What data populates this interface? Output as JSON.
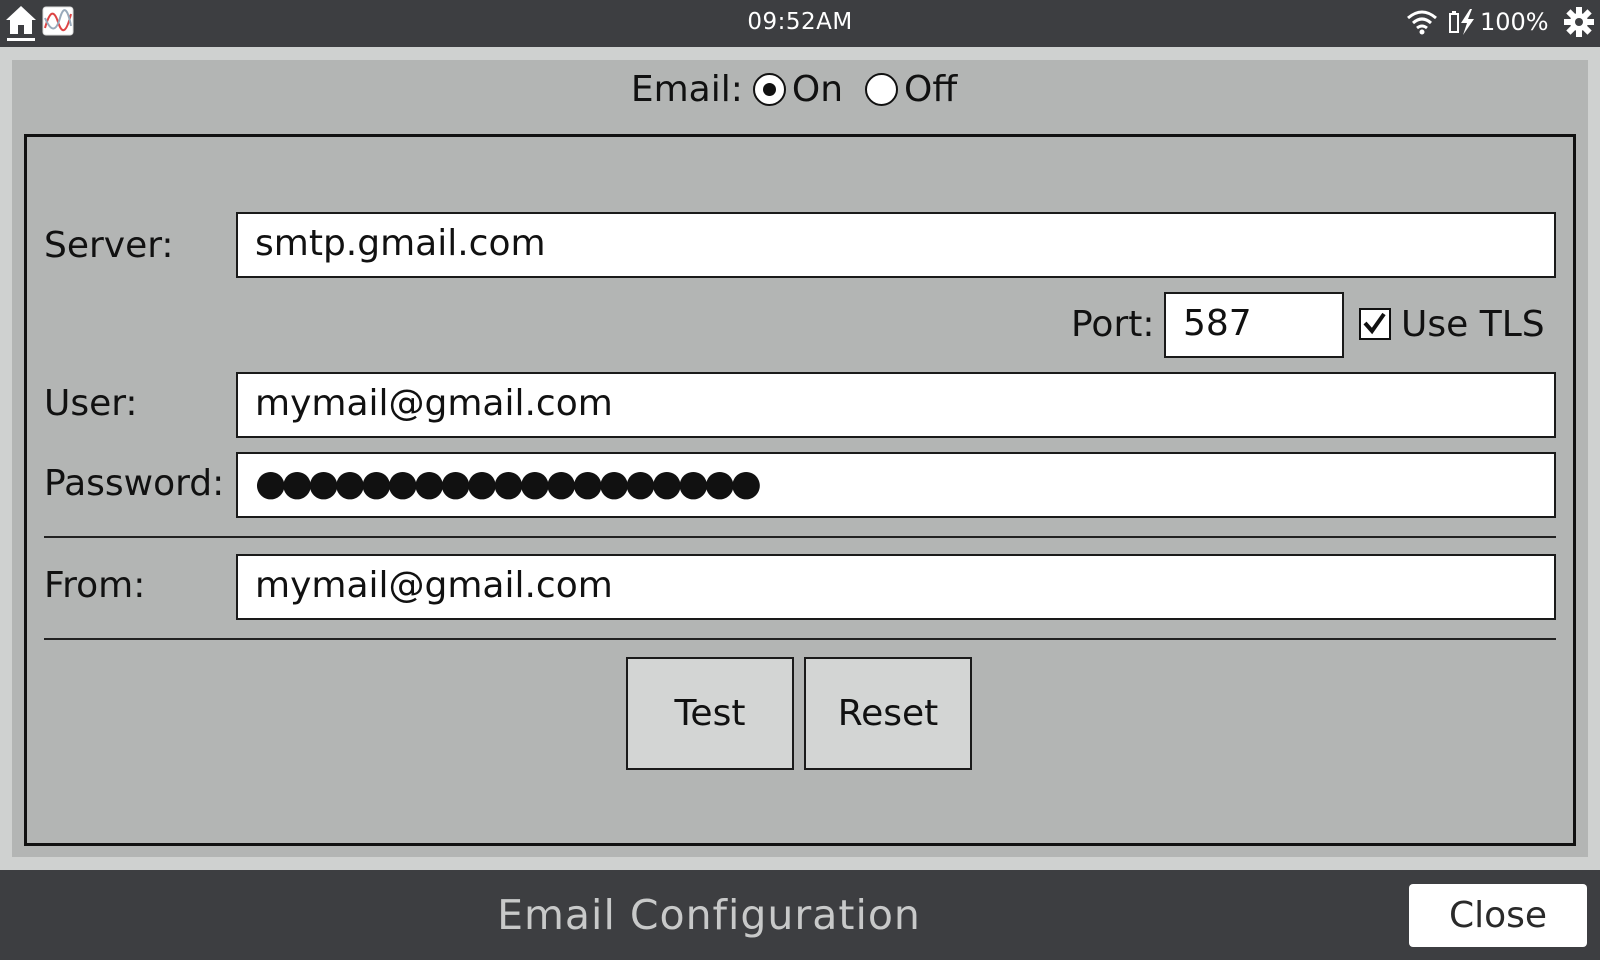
{
  "status_bar": {
    "time": "09:52AM",
    "battery_percent": "100%",
    "icons": [
      "home-icon",
      "chart-app-icon",
      "wifi-icon",
      "battery-charging-icon",
      "gear-icon"
    ]
  },
  "email_toggle": {
    "label": "Email:",
    "options": [
      {
        "label": "On",
        "selected": true
      },
      {
        "label": "Off",
        "selected": false
      }
    ]
  },
  "form": {
    "server_label": "Server:",
    "server_value": "smtp.gmail.com",
    "port_label": "Port:",
    "port_value": "587",
    "tls_label": "Use TLS",
    "tls_checked": true,
    "user_label": "User:",
    "user_value": "mymail@gmail.com",
    "password_label": "Password:",
    "password_mask": "●●●●●●●●●●●●●●●●●●●",
    "from_label": "From:",
    "from_value": "mymail@gmail.com"
  },
  "buttons": {
    "test_label": "Test",
    "reset_label": "Reset"
  },
  "footer": {
    "title": "Email Configuration",
    "close_label": "Close"
  },
  "colors": {
    "bar_bg": "#3d3e41",
    "panel_bg": "#b3b5b4",
    "button_bg": "#d3d5d4"
  }
}
